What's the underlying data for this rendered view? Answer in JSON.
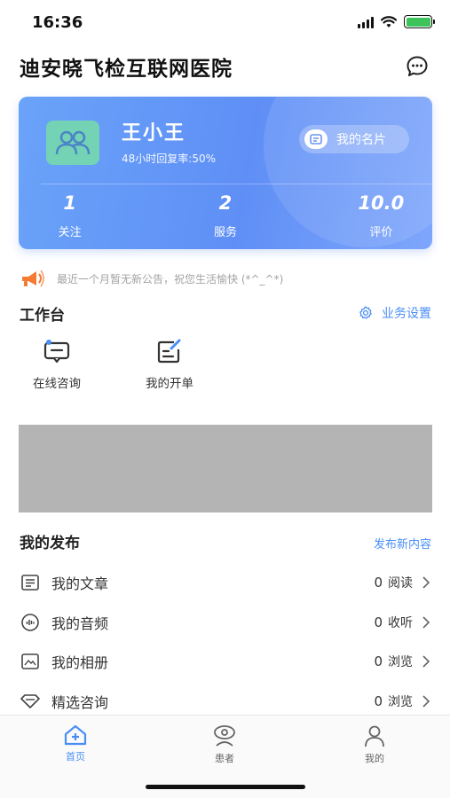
{
  "status_bar": {
    "time": "16:36"
  },
  "header": {
    "title": "迪安晓飞检互联网医院",
    "message_icon": "chat-bubble-icon"
  },
  "profile_card": {
    "name": "王小王",
    "reply_rate": "48小时回复率:50%",
    "card_button_label": "我的名片",
    "stats": [
      {
        "value": "1",
        "label": "关注"
      },
      {
        "value": "2",
        "label": "服务"
      },
      {
        "value": "10.0",
        "label": "评价"
      }
    ],
    "gradient_colors": [
      "#6aa3f9",
      "#5f8ff6"
    ]
  },
  "notice": {
    "text": "最近一个月暂无新公告，祝您生活愉快 (*^_^*)",
    "icon": "megaphone-icon"
  },
  "workbench": {
    "title": "工作台",
    "settings_label": "业务设置",
    "tools": [
      {
        "label": "在线咨询",
        "icon": "chat-consult-icon"
      },
      {
        "label": "我的开单",
        "icon": "edit-order-icon"
      }
    ]
  },
  "publish": {
    "title": "我的发布",
    "new_label": "发布新内容",
    "items": [
      {
        "label": "我的文章",
        "count": "0",
        "unit": "阅读",
        "icon": "article-icon"
      },
      {
        "label": "我的音频",
        "count": "0",
        "unit": "收听",
        "icon": "audio-icon"
      },
      {
        "label": "我的相册",
        "count": "0",
        "unit": "浏览",
        "icon": "album-icon"
      },
      {
        "label": "精选咨询",
        "count": "0",
        "unit": "浏览",
        "icon": "diamond-icon"
      }
    ]
  },
  "tab_bar": {
    "tabs": [
      {
        "label": "首页",
        "icon": "home-icon",
        "active": true
      },
      {
        "label": "患者",
        "icon": "patient-icon",
        "active": false
      },
      {
        "label": "我的",
        "icon": "profile-icon",
        "active": false
      }
    ]
  },
  "colors": {
    "accent": "#4a8ef5",
    "notice_icon": "#f57b32",
    "avatar_bg": "#74d3b4"
  }
}
